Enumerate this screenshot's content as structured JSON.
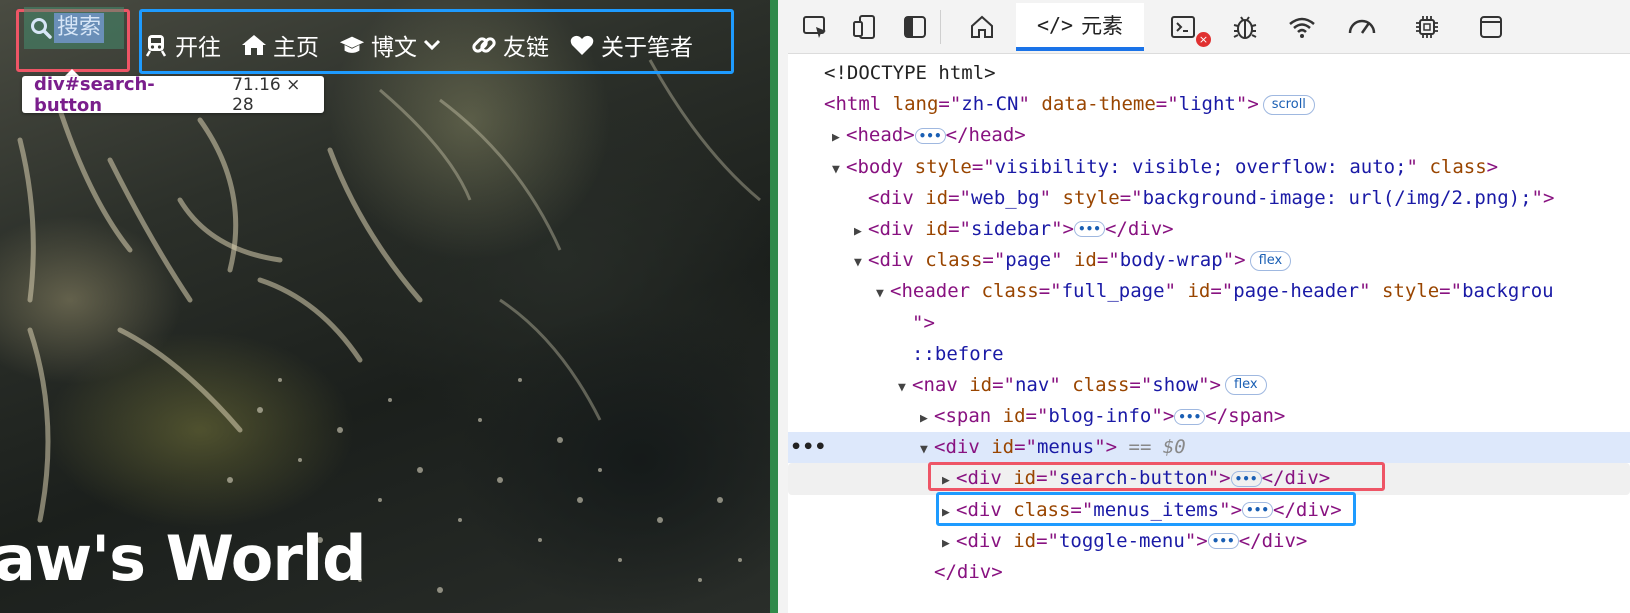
{
  "site": {
    "title_partial": "aw's World",
    "search_label": "搜索",
    "menus": [
      {
        "label": "开往",
        "icon": "train-icon"
      },
      {
        "label": "主页",
        "icon": "home-icon"
      },
      {
        "label": "博文",
        "icon": "graduation-cap-icon",
        "dropdown": true
      },
      {
        "label": "友链",
        "icon": "link-icon"
      },
      {
        "label": "关于笔者",
        "icon": "heart-icon"
      }
    ],
    "tooltip": {
      "tag": "div#search-button",
      "size": "71.16 × 28"
    }
  },
  "devtools": {
    "active_tab": "元素",
    "tab_code_glyph": "</>",
    "error_badge": "×",
    "toolbar_icons": [
      "inspect-icon",
      "device-icon",
      "dock-icon",
      "welcome-home-icon",
      "console-icon",
      "bug-icon",
      "network-icon",
      "performance-icon",
      "memory-icon",
      "application-icon"
    ],
    "tree": [
      {
        "indent": 0,
        "tri": "",
        "parts": [
          [
            "plain",
            "<!DOCTYPE html>"
          ]
        ]
      },
      {
        "indent": 0,
        "tri": "",
        "parts": [
          [
            "tag",
            "<html "
          ],
          [
            "attr",
            "lang"
          ],
          [
            "tag",
            "=\""
          ],
          [
            "val",
            "zh-CN"
          ],
          [
            "tag",
            "\" "
          ],
          [
            "attr",
            "data-theme"
          ],
          [
            "tag",
            "=\""
          ],
          [
            "val",
            "light"
          ],
          [
            "tag",
            "\">"
          ]
        ],
        "pill": "scroll"
      },
      {
        "indent": 1,
        "tri": "▶",
        "parts": [
          [
            "tag",
            "<head>"
          ]
        ],
        "dots": true,
        "after": [
          [
            "tag",
            "</head>"
          ]
        ]
      },
      {
        "indent": 1,
        "tri": "▼",
        "parts": [
          [
            "tag",
            "<body "
          ],
          [
            "attr",
            "style"
          ],
          [
            "tag",
            "=\""
          ],
          [
            "val",
            "visibility: visible; overflow: auto;"
          ],
          [
            "tag",
            "\" "
          ],
          [
            "attr",
            "class"
          ],
          [
            "tag",
            ">"
          ]
        ]
      },
      {
        "indent": 2,
        "tri": "",
        "parts": [
          [
            "tag",
            "<div "
          ],
          [
            "attr",
            "id"
          ],
          [
            "tag",
            "=\""
          ],
          [
            "val",
            "web_bg"
          ],
          [
            "tag",
            "\" "
          ],
          [
            "attr",
            "style"
          ],
          [
            "tag",
            "=\""
          ],
          [
            "val",
            "background-image: url(/img/2.png);"
          ],
          [
            "tag",
            "\">"
          ]
        ]
      },
      {
        "indent": 2,
        "tri": "▶",
        "parts": [
          [
            "tag",
            "<div "
          ],
          [
            "attr",
            "id"
          ],
          [
            "tag",
            "=\""
          ],
          [
            "val",
            "sidebar"
          ],
          [
            "tag",
            "\">"
          ]
        ],
        "dots": true,
        "after": [
          [
            "tag",
            "</div>"
          ]
        ]
      },
      {
        "indent": 2,
        "tri": "▼",
        "parts": [
          [
            "tag",
            "<div "
          ],
          [
            "attr",
            "class"
          ],
          [
            "tag",
            "=\""
          ],
          [
            "val",
            "page"
          ],
          [
            "tag",
            "\" "
          ],
          [
            "attr",
            "id"
          ],
          [
            "tag",
            "=\""
          ],
          [
            "val",
            "body-wrap"
          ],
          [
            "tag",
            "\">"
          ]
        ],
        "pill": "flex"
      },
      {
        "indent": 3,
        "tri": "▼",
        "parts": [
          [
            "tag",
            "<header "
          ],
          [
            "attr",
            "class"
          ],
          [
            "tag",
            "=\""
          ],
          [
            "val",
            "full_page"
          ],
          [
            "tag",
            "\" "
          ],
          [
            "attr",
            "id"
          ],
          [
            "tag",
            "=\""
          ],
          [
            "val",
            "page-header"
          ],
          [
            "tag",
            "\" "
          ],
          [
            "attr",
            "style"
          ],
          [
            "tag",
            "=\""
          ],
          [
            "val",
            "backgrou"
          ]
        ]
      },
      {
        "indent": 4,
        "tri": "",
        "parts": [
          [
            "tag",
            "\">"
          ]
        ]
      },
      {
        "indent": 4,
        "tri": "",
        "parts": [
          [
            "pseudo",
            "::before"
          ]
        ]
      },
      {
        "indent": 4,
        "tri": "▼",
        "parts": [
          [
            "tag",
            "<nav "
          ],
          [
            "attr",
            "id"
          ],
          [
            "tag",
            "=\""
          ],
          [
            "val",
            "nav"
          ],
          [
            "tag",
            "\" "
          ],
          [
            "attr",
            "class"
          ],
          [
            "tag",
            "=\""
          ],
          [
            "val",
            "show"
          ],
          [
            "tag",
            "\">"
          ]
        ],
        "pill": "flex"
      },
      {
        "indent": 5,
        "tri": "▶",
        "parts": [
          [
            "tag",
            "<span "
          ],
          [
            "attr",
            "id"
          ],
          [
            "tag",
            "=\""
          ],
          [
            "val",
            "blog-info"
          ],
          [
            "tag",
            "\">"
          ]
        ],
        "dots": true,
        "after": [
          [
            "tag",
            "</span>"
          ]
        ]
      },
      {
        "indent": 5,
        "tri": "▼",
        "parts": [
          [
            "tag",
            "<div "
          ],
          [
            "attr",
            "id"
          ],
          [
            "tag",
            "=\""
          ],
          [
            "val",
            "menus"
          ],
          [
            "tag",
            "\">"
          ]
        ],
        "comment": " == $0",
        "selected": true
      },
      {
        "indent": 6,
        "tri": "▶",
        "parts": [
          [
            "tag",
            "<div "
          ],
          [
            "attr",
            "id"
          ],
          [
            "tag",
            "=\""
          ],
          [
            "val",
            "search-button"
          ],
          [
            "tag",
            "\">"
          ]
        ],
        "dots": true,
        "after": [
          [
            "tag",
            "</div>"
          ]
        ],
        "hover": true
      },
      {
        "indent": 6,
        "tri": "▶",
        "parts": [
          [
            "tag",
            "<div "
          ],
          [
            "attr",
            "class"
          ],
          [
            "tag",
            "=\""
          ],
          [
            "val",
            "menus_items"
          ],
          [
            "tag",
            "\">"
          ]
        ],
        "dots": true,
        "after": [
          [
            "tag",
            "</div>"
          ]
        ]
      },
      {
        "indent": 6,
        "tri": "▶",
        "parts": [
          [
            "tag",
            "<div "
          ],
          [
            "attr",
            "id"
          ],
          [
            "tag",
            "=\""
          ],
          [
            "val",
            "toggle-menu"
          ],
          [
            "tag",
            "\">"
          ]
        ],
        "dots": true,
        "after": [
          [
            "tag",
            "</div>"
          ]
        ]
      },
      {
        "indent": 5,
        "tri": "",
        "parts": [
          [
            "tag",
            "</div>"
          ]
        ]
      }
    ],
    "more_glyph": "•••"
  }
}
